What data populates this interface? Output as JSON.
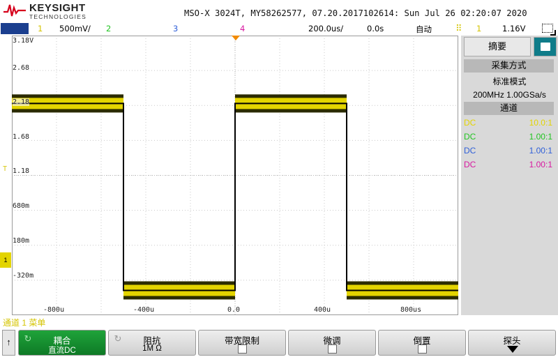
{
  "header": {
    "brand": "KEYSIGHT",
    "brand_sub": "TECHNOLOGIES",
    "instrument_info": "MSO-X 3024T, MY58262577, 07.20.2017102614: Sun Jul 26 02:20:07 2020"
  },
  "status": {
    "menu_label": "",
    "ch1_num": "1",
    "ch1_scale": "500mV/",
    "ch2_num": "2",
    "ch3_num": "3",
    "ch4_num": "4",
    "timebase": "200.0us/",
    "delay": "0.0s",
    "trigger_mode": "自动",
    "trigger_icon": "trigger-edge-icon",
    "trigger_source": "1",
    "trigger_level": "1.16V"
  },
  "graticule": {
    "y_labels": [
      "3.18V",
      "2.68",
      "2.18",
      "1.68",
      "1.18",
      "680m",
      "180m",
      "-320m"
    ],
    "x_labels": [
      "-800u",
      "-400u",
      "0.0",
      "400u",
      "800us"
    ],
    "ground_marker": "1",
    "colors": {
      "ch1": "#e3d400",
      "ch2": "#22c522",
      "ch3": "#2f5fd8",
      "ch4": "#d818a0",
      "grid": "#c8c8c8"
    }
  },
  "chart_data": {
    "type": "line",
    "x_unit": "s",
    "y_unit": "V",
    "xlim": [
      -0.001,
      0.001
    ],
    "ylim": [
      -0.32,
      3.18
    ],
    "series": [
      {
        "x": [
          -0.001,
          -0.0005,
          -0.0005,
          0.0,
          0.0,
          0.0005,
          0.0005,
          0.001
        ],
        "values": [
          2.33,
          2.33,
          -0.01,
          -0.01,
          2.33,
          2.33,
          -0.01,
          -0.01
        ]
      }
    ]
  },
  "sidebar": {
    "tab_summary": "摘要",
    "tab_icon": "display-icon",
    "acq_header": "采集方式",
    "acq_mode": "标准模式",
    "acq_rate": "200MHz  1.00GSa/s",
    "channel_header": "通道",
    "channels": [
      {
        "coupling": "DC",
        "probe": "10.0:1",
        "color": "#e3d400"
      },
      {
        "coupling": "DC",
        "probe": "1.00:1",
        "color": "#22c522"
      },
      {
        "coupling": "DC",
        "probe": "1.00:1",
        "color": "#2f5fd8"
      },
      {
        "coupling": "DC",
        "probe": "1.00:1",
        "color": "#d818a0"
      }
    ]
  },
  "bottom": {
    "channel_menu_label": "通道 1 菜单",
    "softkeys": [
      {
        "label": "耦合",
        "value": "直流DC"
      },
      {
        "label": "阻抗",
        "value": "1M Ω"
      },
      {
        "label": "带宽限制"
      },
      {
        "label": "微调"
      },
      {
        "label": "倒置"
      },
      {
        "label": "探头"
      }
    ]
  }
}
